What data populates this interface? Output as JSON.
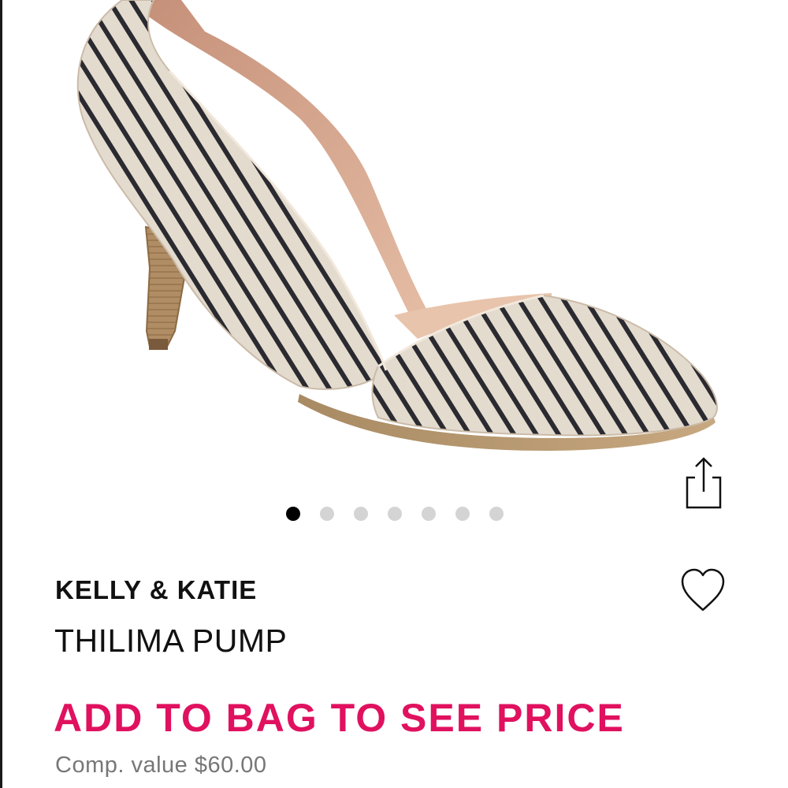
{
  "product": {
    "brand": "KELLY & KATIE",
    "name": "THILIMA PUMP",
    "price_cta": "ADD TO BAG TO SEE PRICE",
    "comp_value": "Comp. value $60.00"
  },
  "gallery": {
    "image_count": 7,
    "active_index": 0,
    "image_subject": "striped pointed-toe pump with wooden heel"
  },
  "icons": {
    "share": "share-icon",
    "wishlist": "heart-icon"
  },
  "colors": {
    "accent": "#e0115f",
    "text": "#111111",
    "muted": "#777777",
    "dot_active": "#000000",
    "dot_inactive": "#d4d4d4"
  }
}
